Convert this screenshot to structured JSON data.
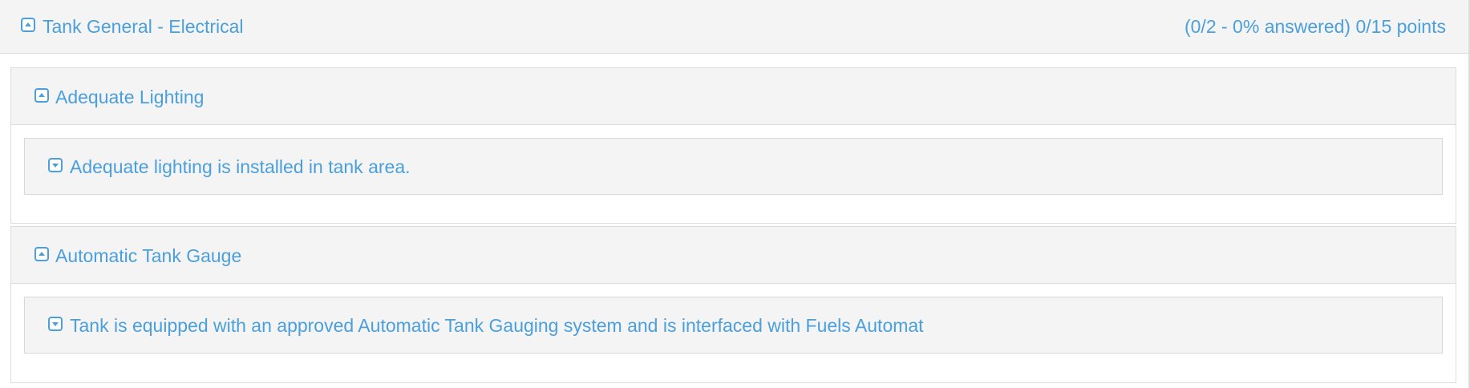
{
  "group": {
    "title": "Tank General - Electrical",
    "summary": "(0/2 - 0% answered) 0/15 points",
    "toggle_icon": "collapse-icon"
  },
  "sections": [
    {
      "title": "Adequate Lighting",
      "toggle_icon": "collapse-icon",
      "items": [
        {
          "text": "Adequate lighting is installed in tank area.",
          "toggle_icon": "expand-icon"
        }
      ]
    },
    {
      "title": "Automatic Tank Gauge",
      "toggle_icon": "collapse-icon",
      "items": [
        {
          "text": "Tank is equipped with an approved Automatic Tank Gauging system and is interfaced with Fuels Automat",
          "toggle_icon": "expand-icon"
        }
      ]
    }
  ],
  "colors": {
    "link": "#4a9fdc",
    "header_bg": "#f4f4f4",
    "border": "#dcdcdc"
  }
}
